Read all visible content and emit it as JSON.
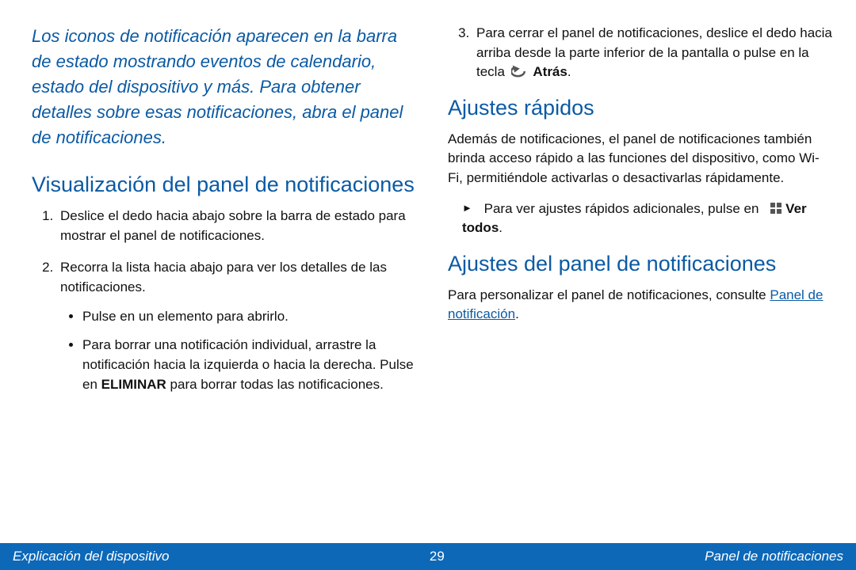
{
  "left": {
    "intro": "Los iconos de notificación aparecen en la barra de estado mostrando eventos de calendario, estado del dispositivo y más. Para obtener detalles sobre esas notificaciones, abra el panel de notificaciones.",
    "heading_view_panel": "Visualización del panel de notificaciones",
    "steps": {
      "s1": "Deslice el dedo hacia abajo sobre la barra de estado para mostrar el panel de notificaciones.",
      "s2": "Recorra la lista hacia abajo para ver los detalles de las notificaciones.",
      "s2_bullets": {
        "b1": "Pulse en un elemento para abrirlo.",
        "b2_pre": "Para borrar una notificación individual, arrastre la notificación hacia la izquierda o hacia la derecha. Pulse en ",
        "b2_bold": "ELIMINAR",
        "b2_post": " para borrar todas las notificaciones."
      }
    }
  },
  "right": {
    "step3_pre": "Para cerrar el panel de notificaciones, deslice el dedo hacia arriba desde la parte inferior de la pantalla o pulse en la tecla ",
    "step3_bold": "Atrás",
    "step3_post": ".",
    "heading_quick_settings": "Ajustes rápidos",
    "quick_settings_body": "Además de notificaciones, el panel de notificaciones también brinda acceso rápido a las funciones del dispositivo, como Wi-Fi, permitiéndole activarlas o desactivarlas rápidamente.",
    "arrow_pre": "Para ver ajustes rápidos adicionales, pulse en",
    "arrow_bold": "Ver todos",
    "arrow_post": ".",
    "heading_panel_settings": "Ajustes del panel de notificaciones",
    "panel_settings_pre": "Para personalizar el panel de notificaciones, consulte ",
    "panel_settings_link": "Panel de notificación",
    "panel_settings_post": "."
  },
  "footer": {
    "left": "Explicación del dispositivo",
    "page": "29",
    "right": "Panel de notificaciones"
  }
}
